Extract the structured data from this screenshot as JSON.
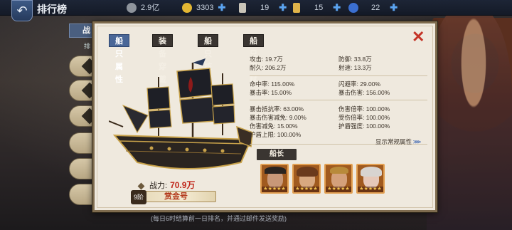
{
  "header": {
    "title": "排行榜",
    "back_icon": "back-arrow-icon",
    "resources": [
      {
        "icon": "silver-coin-icon",
        "value": "2.9亿",
        "color": "#9aa0a8"
      },
      {
        "icon": "gold-coin-icon",
        "value": "3303",
        "color": "#e2b633"
      },
      {
        "icon": "scroll-icon",
        "value": "19",
        "color": "#c9c4b8"
      },
      {
        "icon": "ticket-icon",
        "value": "15",
        "color": "#e0b44a"
      },
      {
        "icon": "blue-gem-icon",
        "value": "22",
        "color": "#3b6fd0"
      }
    ]
  },
  "left_list": {
    "tab_label": "战",
    "sub_label": "排"
  },
  "panel": {
    "tabs": [
      {
        "label": "船只属性",
        "active": true
      },
      {
        "label": "装备穿戴",
        "active": false
      },
      {
        "label": "船只核心",
        "active": false
      },
      {
        "label": "船只天赋",
        "active": false
      }
    ],
    "close_icon": "close-x-icon",
    "power_label": "战力:",
    "power_value": "70.9万",
    "ship_level": "9阶",
    "ship_name": "赏金号",
    "stats": {
      "attack": "攻击: 19.7万",
      "defense": "防御: 33.8万",
      "durability": "耐久: 206.2万",
      "speed": "射速: 13.3万",
      "hit_rate": "命中率: 115.00%",
      "dodge_rate": "闪避率: 29.00%",
      "crit_rate": "暴击率: 15.00%",
      "crit_damage": "暴击伤害: 156.00%",
      "crit_resist": "暴击抵抗率: 63.00%",
      "damage_rate": "伤害倍率: 100.00%",
      "crit_damage_reduce": "暴击伤害减免: 9.00%",
      "damage_taken_rate": "受伤倍率: 100.00%",
      "damage_reduce": "伤害减免: 15.00%",
      "shield_strength": "护盾强度: 100.00%",
      "shield_cap": "护盾上限: 100.00%"
    },
    "show_more": "显示常规属性",
    "captain_label": "船长",
    "captains": [
      {
        "name": "captain-1",
        "stars": "★★★★★"
      },
      {
        "name": "captain-2",
        "stars": "★★★★★"
      },
      {
        "name": "captain-3",
        "stars": "★★★★★"
      },
      {
        "name": "captain-4",
        "stars": "★★★★★"
      }
    ]
  },
  "footer_note": "(每日6时结算前一日排名，并通过邮件发送奖励)"
}
